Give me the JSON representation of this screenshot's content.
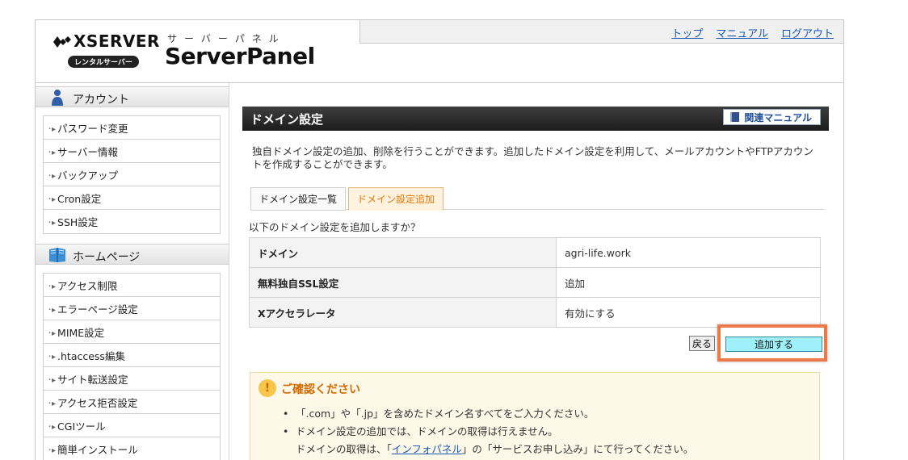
{
  "header": {
    "brand": "XSERVER",
    "badge": "レンタルサーバー",
    "panel_jp": "サーバーパネル",
    "panel_en": "ServerPanel",
    "nav": [
      "トップ",
      "マニュアル",
      "ログアウト"
    ]
  },
  "sidebar": {
    "sections": [
      {
        "title": "アカウント",
        "icon": "person-icon",
        "items": [
          "パスワード変更",
          "サーバー情報",
          "バックアップ",
          "Cron設定",
          "SSH設定"
        ]
      },
      {
        "title": "ホームページ",
        "icon": "book-icon",
        "items": [
          "アクセス制限",
          "エラーページ設定",
          "MIME設定",
          ".htaccess編集",
          "サイト転送設定",
          "アクセス拒否設定",
          "CGIツール",
          "簡単インストール"
        ]
      }
    ]
  },
  "main": {
    "title": "ドメイン設定",
    "manual_button": "関連マニュアル",
    "description": "独自ドメイン設定の追加、削除を行うことができます。追加したドメイン設定を利用して、メールアカウントやFTPアカウントを作成することができます。",
    "tabs": [
      "ドメイン設定一覧",
      "ドメイン設定追加"
    ],
    "active_tab": "ドメイン設定追加",
    "confirm_question": "以下のドメイン設定を追加しますか？",
    "rows": [
      {
        "key": "ドメイン",
        "value": "agri-life.work"
      },
      {
        "key": "無料独自SSL設定",
        "value": "追加"
      },
      {
        "key": "Xアクセラレータ",
        "value": "有効にする"
      }
    ],
    "back_button": "戻る",
    "add_button": "追加する",
    "notice": {
      "title": "ご確認ください",
      "item1": "「.com」や「.jp」を含めたドメイン名すべてをご入力ください。",
      "item2": "ドメイン設定の追加では、ドメインの取得は行えません。",
      "item2_sub_pre": "ドメインの取得は、「",
      "item2_sub_link": "インフォパネル",
      "item2_sub_post": "」の「サービスお申し込み」にて行ってください。"
    }
  },
  "colors": {
    "accent_orange": "#ec7a49",
    "add_button_bg": "#9ff0fb",
    "link": "#1a5ab5"
  }
}
